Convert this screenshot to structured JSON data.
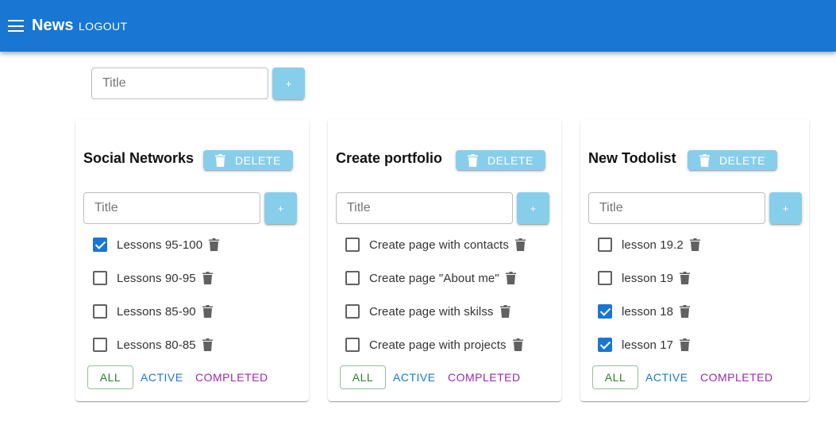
{
  "appbar": {
    "title": "News",
    "logout_label": "LOGOUT",
    "color": "#1976d2"
  },
  "add_todolist": {
    "placeholder": "Title",
    "button_label": "+"
  },
  "todolists": [
    {
      "title": "Social Networks",
      "delete_label": "DELETE",
      "input_placeholder": "Title",
      "add_label": "+",
      "tasks": [
        {
          "title": "Lessons 95-100",
          "done": true
        },
        {
          "title": "Lessons 90-95",
          "done": false
        },
        {
          "title": "Lessons 85-90",
          "done": false
        },
        {
          "title": "Lessons 80-85",
          "done": false
        }
      ],
      "filters": {
        "all": "ALL",
        "active": "ACTIVE",
        "completed": "COMPLETED"
      }
    },
    {
      "title": "Create portfolio",
      "delete_label": "DELETE",
      "input_placeholder": "Title",
      "add_label": "+",
      "tasks": [
        {
          "title": "Create page with contacts",
          "done": false
        },
        {
          "title": "Create page \"About me\"",
          "done": false
        },
        {
          "title": "Create page with skilss",
          "done": false
        },
        {
          "title": "Create page with projects",
          "done": false
        }
      ],
      "filters": {
        "all": "ALL",
        "active": "ACTIVE",
        "completed": "COMPLETED"
      }
    },
    {
      "title": "New Todolist",
      "delete_label": "DELETE",
      "input_placeholder": "Title",
      "add_label": "+",
      "tasks": [
        {
          "title": "lesson 19.2",
          "done": false
        },
        {
          "title": "lesson 19",
          "done": false
        },
        {
          "title": "lesson 18",
          "done": true
        },
        {
          "title": "lesson 17",
          "done": true
        }
      ],
      "filters": {
        "all": "ALL",
        "active": "ACTIVE",
        "completed": "COMPLETED"
      }
    }
  ],
  "icons": {
    "menu": "menu-icon",
    "delete": "trash-icon"
  },
  "colors": {
    "accent_button": "#87ceeb",
    "checkbox_checked": "#1976d2",
    "filter_all": "#2e7d32",
    "filter_active": "#1976d2",
    "filter_completed": "#9c27b0"
  }
}
